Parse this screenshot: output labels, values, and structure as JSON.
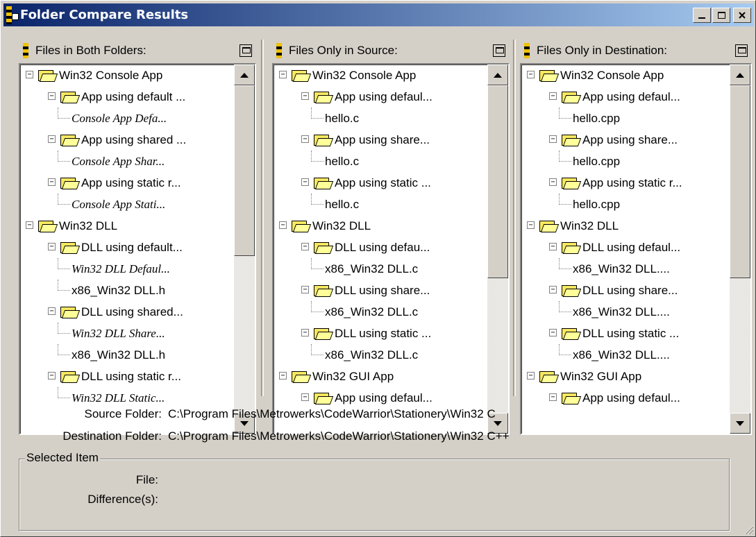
{
  "window": {
    "title": "Folder Compare Results",
    "icon": "folder-compare-app-icon",
    "controls": {
      "minimize": "_",
      "maximize": "□",
      "close": "×"
    }
  },
  "panes": [
    {
      "title": "Files in Both Folders:",
      "rows": [
        {
          "level": 0,
          "type": "folder",
          "expander": "−",
          "label": "Win32 Console App"
        },
        {
          "level": 1,
          "type": "folder",
          "expander": "−",
          "label": "App using default ..."
        },
        {
          "level": 2,
          "type": "file",
          "italic": true,
          "label": "Console App Defa..."
        },
        {
          "level": 1,
          "type": "folder",
          "expander": "−",
          "label": "App using shared ..."
        },
        {
          "level": 2,
          "type": "file",
          "italic": true,
          "label": "Console App Shar..."
        },
        {
          "level": 1,
          "type": "folder",
          "expander": "−",
          "label": "App using static r..."
        },
        {
          "level": 2,
          "type": "file",
          "italic": true,
          "label": "Console App Stati..."
        },
        {
          "level": 0,
          "type": "folder",
          "expander": "−",
          "label": "Win32 DLL"
        },
        {
          "level": 1,
          "type": "folder",
          "expander": "−",
          "label": "DLL using default..."
        },
        {
          "level": 2,
          "type": "file",
          "italic": true,
          "label": "Win32 DLL Defaul..."
        },
        {
          "level": 2,
          "type": "file",
          "italic": false,
          "label": "x86_Win32 DLL.h"
        },
        {
          "level": 1,
          "type": "folder",
          "expander": "−",
          "label": "DLL using shared..."
        },
        {
          "level": 2,
          "type": "file",
          "italic": true,
          "label": "Win32 DLL Share..."
        },
        {
          "level": 2,
          "type": "file",
          "italic": false,
          "label": "x86_Win32 DLL.h"
        },
        {
          "level": 1,
          "type": "folder",
          "expander": "−",
          "label": "DLL using static r..."
        },
        {
          "level": 2,
          "type": "file",
          "italic": true,
          "label": "Win32 DLL Static..."
        }
      ]
    },
    {
      "title": "Files Only in Source:",
      "rows": [
        {
          "level": 0,
          "type": "folder",
          "expander": "−",
          "label": "Win32 Console App"
        },
        {
          "level": 1,
          "type": "folder",
          "expander": "−",
          "label": "App using defaul..."
        },
        {
          "level": 2,
          "type": "file",
          "italic": false,
          "label": "hello.c"
        },
        {
          "level": 1,
          "type": "folder",
          "expander": "−",
          "label": "App using share..."
        },
        {
          "level": 2,
          "type": "file",
          "italic": false,
          "label": "hello.c"
        },
        {
          "level": 1,
          "type": "folder",
          "expander": "−",
          "label": "App using static ..."
        },
        {
          "level": 2,
          "type": "file",
          "italic": false,
          "label": "hello.c"
        },
        {
          "level": 0,
          "type": "folder",
          "expander": "−",
          "label": "Win32 DLL"
        },
        {
          "level": 1,
          "type": "folder",
          "expander": "−",
          "label": "DLL using defau..."
        },
        {
          "level": 2,
          "type": "file",
          "italic": false,
          "label": "x86_Win32 DLL.c"
        },
        {
          "level": 1,
          "type": "folder",
          "expander": "−",
          "label": "DLL using share..."
        },
        {
          "level": 2,
          "type": "file",
          "italic": false,
          "label": "x86_Win32 DLL.c"
        },
        {
          "level": 1,
          "type": "folder",
          "expander": "−",
          "label": "DLL using static ..."
        },
        {
          "level": 2,
          "type": "file",
          "italic": false,
          "label": "x86_Win32 DLL.c"
        },
        {
          "level": 0,
          "type": "folder",
          "expander": "−",
          "label": "Win32 GUI App"
        },
        {
          "level": 1,
          "type": "folder",
          "expander": "−",
          "label": "App using defaul..."
        }
      ]
    },
    {
      "title": "Files Only in Destination:",
      "rows": [
        {
          "level": 0,
          "type": "folder",
          "expander": "−",
          "label": "Win32 Console App"
        },
        {
          "level": 1,
          "type": "folder",
          "expander": "−",
          "label": "App using defaul..."
        },
        {
          "level": 2,
          "type": "file",
          "italic": false,
          "label": "hello.cpp"
        },
        {
          "level": 1,
          "type": "folder",
          "expander": "−",
          "label": "App using share..."
        },
        {
          "level": 2,
          "type": "file",
          "italic": false,
          "label": "hello.cpp"
        },
        {
          "level": 1,
          "type": "folder",
          "expander": "−",
          "label": "App using static r..."
        },
        {
          "level": 2,
          "type": "file",
          "italic": false,
          "label": "hello.cpp"
        },
        {
          "level": 0,
          "type": "folder",
          "expander": "−",
          "label": "Win32 DLL"
        },
        {
          "level": 1,
          "type": "folder",
          "expander": "−",
          "label": "DLL using defaul..."
        },
        {
          "level": 2,
          "type": "file",
          "italic": false,
          "label": "x86_Win32 DLL...."
        },
        {
          "level": 1,
          "type": "folder",
          "expander": "−",
          "label": "DLL using share..."
        },
        {
          "level": 2,
          "type": "file",
          "italic": false,
          "label": "x86_Win32 DLL...."
        },
        {
          "level": 1,
          "type": "folder",
          "expander": "−",
          "label": "DLL using static ..."
        },
        {
          "level": 2,
          "type": "file",
          "italic": false,
          "label": "x86_Win32 DLL...."
        },
        {
          "level": 0,
          "type": "folder",
          "expander": "−",
          "label": "Win32 GUI App"
        },
        {
          "level": 1,
          "type": "folder",
          "expander": "−",
          "label": "App using defaul..."
        }
      ]
    }
  ],
  "info": {
    "source_label": "Source Folder:",
    "source_value": "C:\\Program Files\\Metrowerks\\CodeWarrior\\Stationery\\Win32 C",
    "destination_label": "Destination Folder:",
    "destination_value": "C:\\Program Files\\Metrowerks\\CodeWarrior\\Stationery\\Win32 C++"
  },
  "selected_item": {
    "group_title": "Selected Item",
    "file_label": "File:",
    "differences_label": "Difference(s):"
  },
  "colors": {
    "title_gradient_start": "#0a246a",
    "title_gradient_end": "#a6caf0",
    "face": "#d4d0c8",
    "folder_yellow": "#f8e860"
  }
}
